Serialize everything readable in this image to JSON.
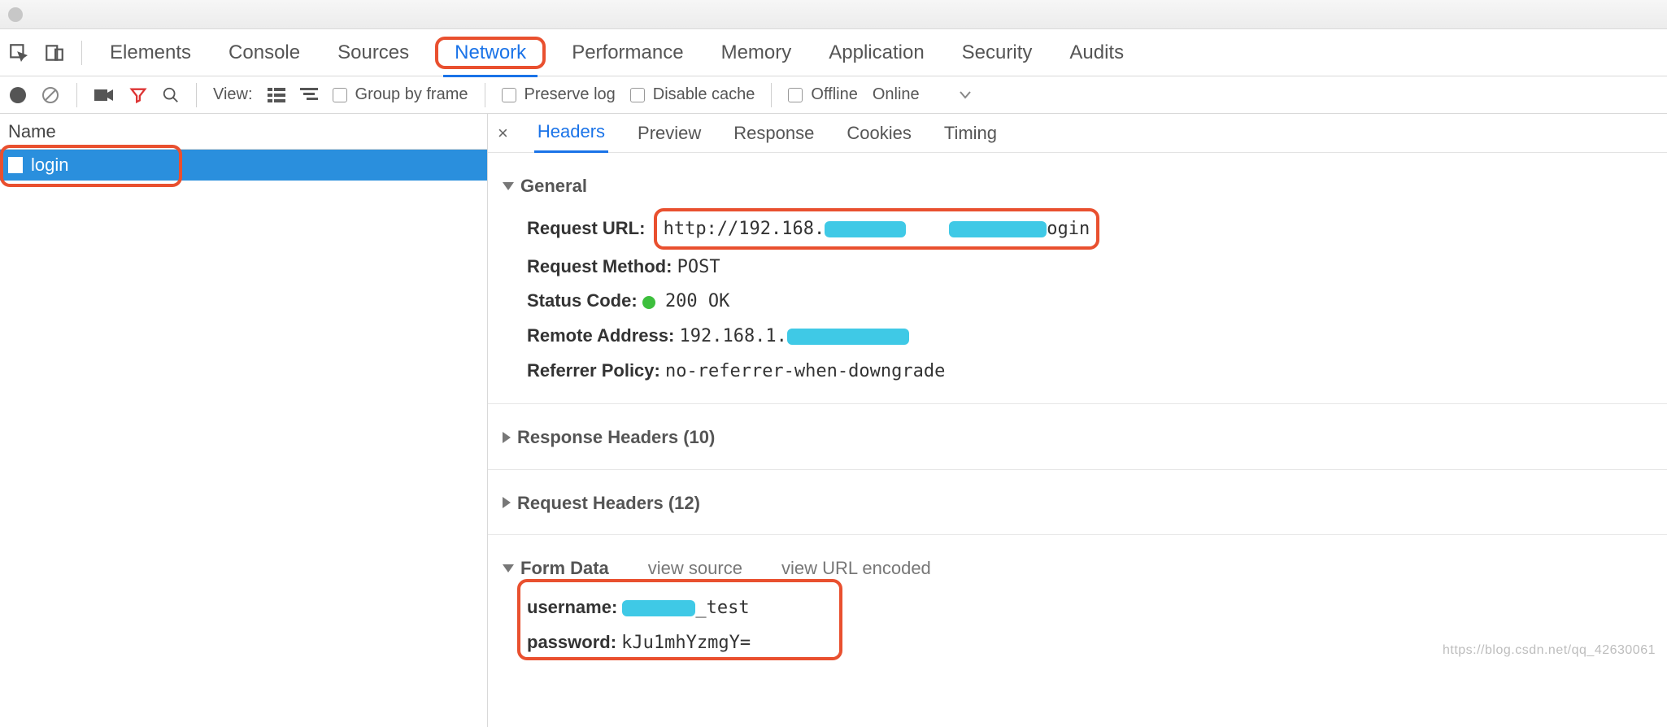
{
  "tabs": {
    "elements": "Elements",
    "console": "Console",
    "sources": "Sources",
    "network": "Network",
    "performance": "Performance",
    "memory": "Memory",
    "application": "Application",
    "security": "Security",
    "audits": "Audits"
  },
  "toolbar": {
    "view_label": "View:",
    "group_by_frame": "Group by frame",
    "preserve_log": "Preserve log",
    "disable_cache": "Disable cache",
    "offline": "Offline",
    "online": "Online"
  },
  "left": {
    "header": "Name",
    "requests": [
      {
        "name": "login"
      }
    ]
  },
  "detail_tabs": {
    "headers": "Headers",
    "preview": "Preview",
    "response": "Response",
    "cookies": "Cookies",
    "timing": "Timing"
  },
  "sections": {
    "general": "General",
    "response_headers": "Response Headers (10)",
    "request_headers": "Request Headers (12)",
    "form_data": "Form Data",
    "view_source": "view source",
    "view_url_encoded": "view URL encoded"
  },
  "general": {
    "request_url_label": "Request URL:",
    "request_url_pre": "http://192.168.",
    "request_url_post": "ogin",
    "request_method_label": "Request Method:",
    "request_method": "POST",
    "status_code_label": "Status Code:",
    "status_code": "200 OK",
    "remote_address_label": "Remote Address:",
    "remote_address_pre": "192.168.1.",
    "referrer_policy_label": "Referrer Policy:",
    "referrer_policy": "no-referrer-when-downgrade"
  },
  "form_data": {
    "username_label": "username:",
    "username_val": "_test",
    "password_label": "password:",
    "password_val": "kJu1mhYzmgY="
  },
  "watermark": "https://blog.csdn.net/qq_42630061"
}
